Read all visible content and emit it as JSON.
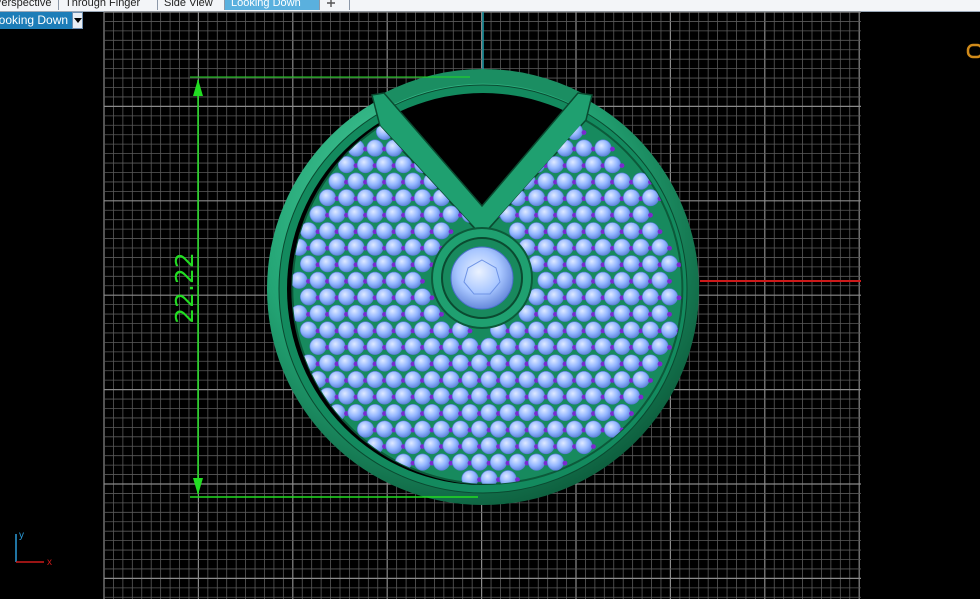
{
  "tabs": [
    {
      "label": "Perspective",
      "active": false
    },
    {
      "label": "Through Finger",
      "active": false
    },
    {
      "label": "Side View",
      "active": false
    },
    {
      "label": "Looking Down",
      "active": true
    }
  ],
  "add_tab_icon": "plus-icon",
  "viewport": {
    "title": "Looking Down",
    "dropdown_icon": "chevron-down-icon"
  },
  "dimension": {
    "value": "22.22"
  },
  "axis_indicator": {
    "y_label": "y",
    "x_label": "x"
  },
  "colors": {
    "background": "#000000",
    "grid": "#5a5a5a",
    "grid_major": "#8a8a8a",
    "dimension": "#22dd22",
    "x_axis": "#cc1a1a",
    "y_axis": "#1a9aa8",
    "metal": "#1f9a6c",
    "gem": "#8ab4ff",
    "prong": "#7a2ad0",
    "active_tab": "#5ab0de"
  }
}
